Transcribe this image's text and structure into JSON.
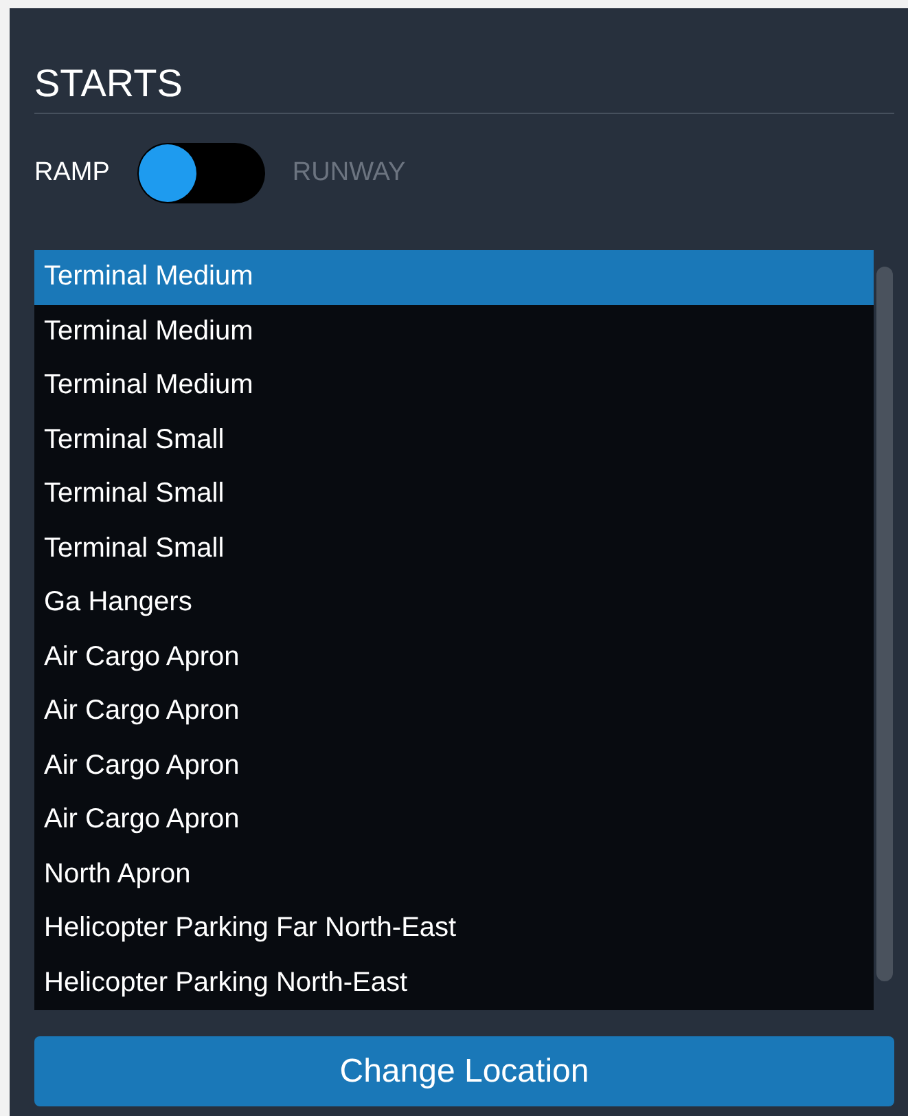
{
  "section_title": "STARTS",
  "start_type": {
    "left_label": "RAMP",
    "right_label": "RUNWAY",
    "on": false
  },
  "locations": [
    {
      "label": "Terminal Medium",
      "selected": true
    },
    {
      "label": "Terminal Medium",
      "selected": false
    },
    {
      "label": "Terminal Medium",
      "selected": false
    },
    {
      "label": "Terminal Small",
      "selected": false
    },
    {
      "label": "Terminal Small",
      "selected": false
    },
    {
      "label": "Terminal Small",
      "selected": false
    },
    {
      "label": "Ga Hangers",
      "selected": false
    },
    {
      "label": "Air Cargo Apron",
      "selected": false
    },
    {
      "label": "Air Cargo Apron",
      "selected": false
    },
    {
      "label": "Air Cargo Apron",
      "selected": false
    },
    {
      "label": "Air Cargo Apron",
      "selected": false
    },
    {
      "label": "North Apron",
      "selected": false
    },
    {
      "label": "Helicopter Parking Far North-East",
      "selected": false
    },
    {
      "label": "Helicopter Parking North-East",
      "selected": false
    }
  ],
  "button": "Change Location"
}
